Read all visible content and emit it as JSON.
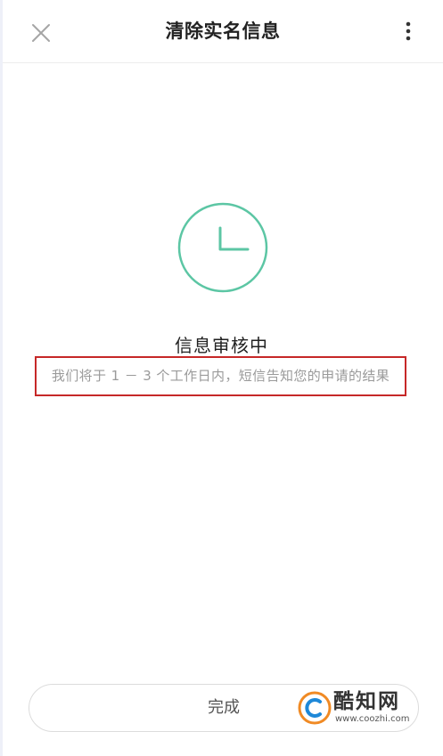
{
  "header": {
    "title": "清除实名信息",
    "close_icon": "close-icon",
    "more_icon": "more-vertical-icon"
  },
  "status": {
    "icon": "clock-icon",
    "icon_color": "#5cc6a4",
    "title": "信息审核中",
    "description": "我们将于 1 － 3 个工作日内，短信告知您的申请的结果"
  },
  "highlight_color": "#c62828",
  "footer": {
    "done_label": "完成"
  },
  "watermark": {
    "name": "酷知网",
    "url": "www.coozhi.com"
  }
}
